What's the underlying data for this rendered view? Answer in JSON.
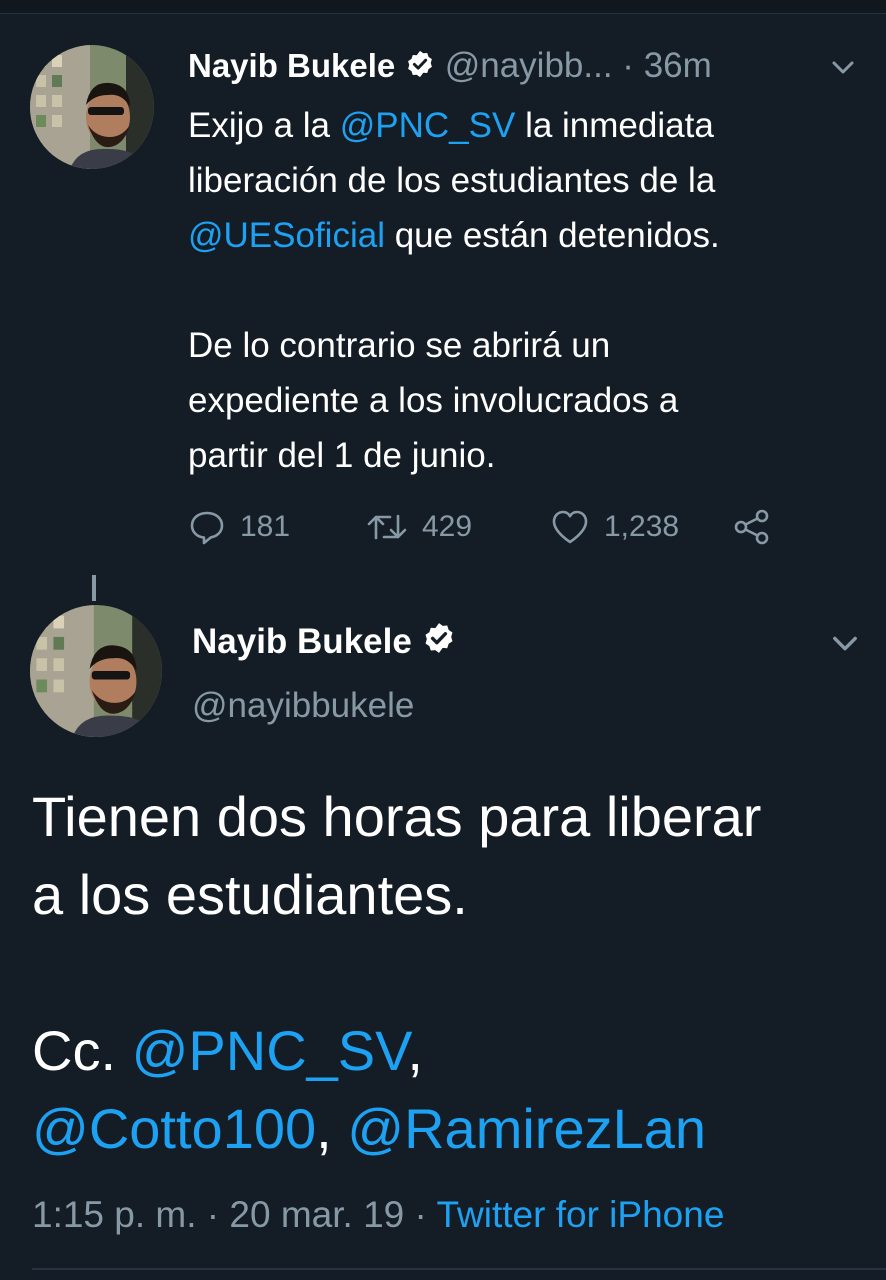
{
  "colors": {
    "background": "#141d26",
    "text": "#ffffff",
    "secondary": "#8899a6",
    "accent": "#1da1f2"
  },
  "tweet1": {
    "display_name": "Nayib Bukele",
    "handle": "@nayibb...",
    "separator": "·",
    "time": "36m",
    "text": {
      "line1_a": "Exijo a la ",
      "line1_mention": "@PNC_SV",
      "line1_b": " la inmediata",
      "line2": "liberación de los estudiantes de la",
      "line3_mention": "@UESoficial",
      "line3_b": " que están detenidos.",
      "para2_line1": "De lo contrario se abrirá un",
      "para2_line2": "expediente a los involucrados a",
      "para2_line3": "partir del 1 de junio."
    },
    "actions": {
      "replies": "181",
      "retweets": "429",
      "likes": "1,238"
    },
    "icons": [
      "reply-icon",
      "retweet-icon",
      "like-icon",
      "share-icon",
      "verified-icon",
      "chevron-down-icon"
    ]
  },
  "tweet2": {
    "display_name": "Nayib Bukele",
    "handle": "@nayibbukele",
    "text": {
      "line1": "Tienen dos horas para liberar",
      "line2": "a los estudiantes.",
      "cc_prefix": "Cc. ",
      "mention1": "@PNC_SV",
      "comma1": ",",
      "mention2": "@Cotto100",
      "comma2": ", ",
      "mention3": "@RamirezLan"
    },
    "meta": {
      "time": "1:15 p. m.",
      "sep1": " · ",
      "date": "20 mar. 19",
      "sep2": " · ",
      "source": "Twitter for iPhone"
    }
  }
}
